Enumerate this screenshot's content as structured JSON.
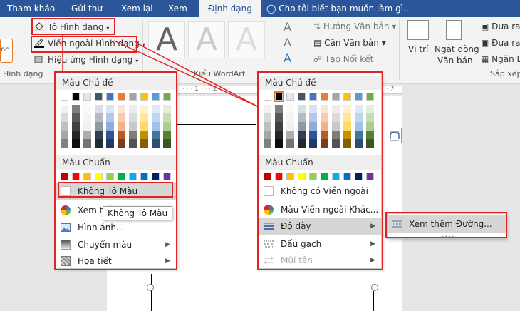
{
  "tabs": [
    {
      "label": "Tham khảo"
    },
    {
      "label": "Gửi thư"
    },
    {
      "label": "Xem lại"
    },
    {
      "label": "Xem"
    },
    {
      "label": "Định dạng"
    }
  ],
  "tell_me": "Cho tôi biết bạn muốn làm gì...",
  "ribbon": {
    "fill_button": "Tô Hình dạng",
    "outline_button": "Viền ngoài Hình dạng",
    "effects_button": "Hiệu ứng Hình dạng",
    "shape_group_label": "Hình dạng",
    "wordart_group_label": "Kiểu WordArt",
    "wordart_sample": "A",
    "text_direction": "Hướng Văn bản",
    "align_text": "Căn Văn bản",
    "create_link": "Tạo Nối kết",
    "position": "Vị trí",
    "wrap_text_line1": "Ngắt dòng",
    "wrap_text_line2": "Văn bản",
    "bring_forward": "Đưa ra",
    "send_backward": "Đưa ra s",
    "selection_pane": "Ngăn L",
    "arrange_group_label": "Sắp xếp",
    "sample_left": "oc"
  },
  "ruler": {
    "marks": "· · · 1 · · · 2 · · ·",
    "right_mark": "· 7"
  },
  "fill_menu": {
    "theme_header": "Màu Chủ đề",
    "standard_header": "Màu Chuẩn",
    "no_fill": "Không Tô Màu",
    "more_colors": "Xem thê",
    "picture": "Hình ảnh...",
    "gradient": "Chuyển màu",
    "texture": "Họa tiết"
  },
  "tooltip": "Không Tô Màu",
  "outline_menu": {
    "theme_header": "Màu Chủ đề",
    "standard_header": "Màu Chuẩn",
    "no_outline": "Không có Viền ngoài",
    "more_colors": "Màu Viền ngoài Khác...",
    "weight": "Độ dày",
    "dashes": "Dấu gạch",
    "arrows": "Mũi tên"
  },
  "weight_submenu": {
    "more_lines": "Xem thêm Đường..."
  },
  "colors": {
    "theme_top": [
      "#ffffff",
      "#000000",
      "#e7e6e6",
      "#44546a",
      "#4472c4",
      "#ed7d31",
      "#a5a5a5",
      "#ffc000",
      "#5b9bd5",
      "#70ad47"
    ],
    "standard": [
      "#c00000",
      "#ff0000",
      "#ffc000",
      "#ffff00",
      "#92d050",
      "#00b050",
      "#00b0f0",
      "#0070c0",
      "#002060",
      "#7030a0"
    ],
    "annotation": "#e02424",
    "ribbon_accent": "#2b579a"
  }
}
